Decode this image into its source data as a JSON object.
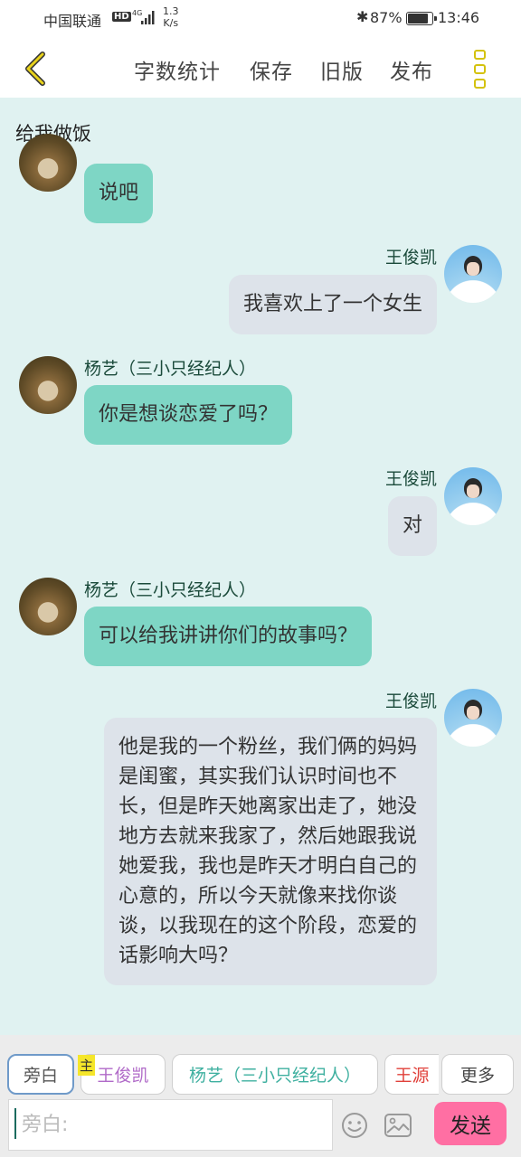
{
  "status_bar": {
    "carrier": "中国联通",
    "hd_badge": "HD",
    "network": "4G",
    "speed_value": "1.3",
    "speed_unit": "K/s",
    "battery_percent": "87%",
    "battery_level": 0.87,
    "time": "13:46"
  },
  "toolbar": {
    "back_icon": "chevron-left-icon",
    "word_count": "字数统计",
    "save": "保存",
    "old_version": "旧版",
    "publish": "发布",
    "more_icon": "more-vertical-icon"
  },
  "chat": {
    "title": "给我做饭",
    "messages": [
      {
        "side": "left",
        "speaker": "",
        "text": "说吧"
      },
      {
        "side": "right",
        "speaker": "王俊凯",
        "text": "我喜欢上了一个女生"
      },
      {
        "side": "left",
        "speaker": "杨艺（三小只经纪人）",
        "text": "你是想谈恋爱了吗？"
      },
      {
        "side": "right",
        "speaker": "王俊凯",
        "text": "对"
      },
      {
        "side": "left",
        "speaker": "杨艺（三小只经纪人）",
        "text": "可以给我讲讲你们的故事吗？"
      },
      {
        "side": "right",
        "speaker": "王俊凯",
        "text": "他是我的一个粉丝，我们俩的妈妈是闺蜜，其实我们认识时间也不长，但是昨天她离家出走了，她没地方去就来我家了，然后她跟我说她爱我，我也是昨天才明白自己的心意的，所以今天就像来找你谈谈，以我现在的这个阶段，恋爱的话影响大吗？"
      }
    ]
  },
  "roles": {
    "narrator": "旁白",
    "host_badge": "主",
    "role1": "王俊凯",
    "role2": "杨艺（三小只经纪人）",
    "role3": "王源",
    "more": "更多",
    "colors": {
      "role1": "#b06ac8",
      "role2": "#3fb0a0",
      "role3": "#e0403a"
    }
  },
  "input": {
    "placeholder": "旁白:",
    "value": "",
    "emoji_icon": "emoji-icon",
    "image_icon": "image-icon",
    "send": "发送"
  }
}
